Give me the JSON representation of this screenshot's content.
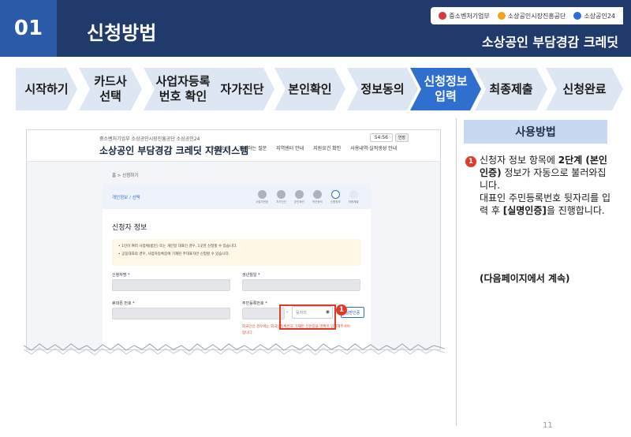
{
  "header": {
    "number": "01",
    "title": "신청방법",
    "subtitle": "소상공인 부담경감 크레딧",
    "logos": [
      "중소벤처기업부",
      "소상공인시장진흥공단",
      "소상공인24"
    ]
  },
  "steps": [
    {
      "label": "시작하기",
      "active": false
    },
    {
      "label": "카드사\n선택",
      "active": false
    },
    {
      "label": "사업자등록\n번호 확인",
      "active": false
    },
    {
      "label": "자가진단",
      "active": false
    },
    {
      "label": "본인확인",
      "active": false
    },
    {
      "label": "정보동의",
      "active": false
    },
    {
      "label": "신청정보\n입력",
      "active": true
    },
    {
      "label": "최종제출",
      "active": false
    },
    {
      "label": "신청완료",
      "active": false
    }
  ],
  "screenshot": {
    "logo_text": "중소벤처기업부  소상공인시장진흥공단  소상공인24",
    "brand": "소상공인 부담경감 크레딧 지원시스템",
    "nav": [
      "사업소개",
      "자주하는 질문",
      "지역센터 안내",
      "지원요건 확인",
      "사용내역·실적생성 안내"
    ],
    "timer": "54:56",
    "extend": "연장",
    "breadcrumb": "홈  >  신청하기",
    "panel_title": "개인정보 / 선택",
    "mini_steps": [
      "사업자번호",
      "자가진단",
      "본인확인",
      "약관동의",
      "신청정보",
      "최종제출"
    ],
    "section_title": "신청자 정보",
    "notes": [
      "• 1인이 여러 사업체(법인) 또는 개인일 대표인 경우, 1곳만 신청할 수 있습니다.",
      "• 공동대표의 경우, 사업자등록증에 기재된 주대표자만 신청할 수 있습니다."
    ],
    "label_name": "신청자명 *",
    "label_birth": "생년월일 *",
    "label_phone": "휴대폰 번호 *",
    "label_rrn": "주민등록번호 *",
    "rrn_back_placeholder": "뒷자리",
    "verify_label": "실명인증",
    "warning": "외국인인 경우에는 외국인등록번호 기재된 신분증을 명확히 입력해주셔야 합니다."
  },
  "callout_number": "1",
  "usage": {
    "heading": "사용방법",
    "badge": "1",
    "line1_pre": "신청자 정보 항목에 ",
    "line1_bold": "2단계 (본인인증)",
    "line1_post": " 정보가 자동으로 불러와집니다.",
    "line2_pre": "대표인 주민등록번호 뒷자리를 입력 후 ",
    "line2_bold": "[실명인증]",
    "line2_post": "을 진행합니다.",
    "next": "(다음페이지에서 계속)"
  },
  "page_number": "11",
  "colors": {
    "header_bg": "#1f3a6b",
    "accent": "#2f6fd0",
    "step_bg": "#dde7f3",
    "callout": "#e03a2a"
  }
}
